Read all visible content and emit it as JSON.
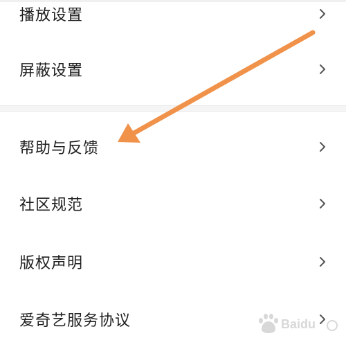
{
  "settings": {
    "items": [
      {
        "label": "播放设置"
      },
      {
        "label": "屏蔽设置"
      },
      {
        "label": "帮助与反馈"
      },
      {
        "label": "社区规范"
      },
      {
        "label": "版权声明"
      },
      {
        "label": "爱奇艺服务协议"
      }
    ]
  },
  "annotation": {
    "arrow_color": "#f0924a"
  },
  "watermark": {
    "text": "Baidu"
  }
}
